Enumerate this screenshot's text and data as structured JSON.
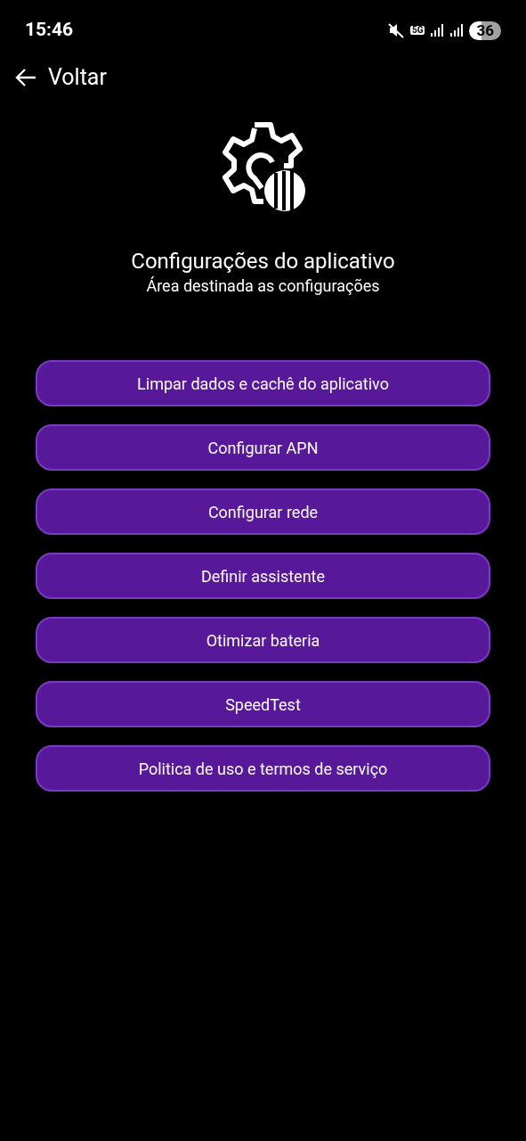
{
  "status_bar": {
    "time": "15:46",
    "network": "5G",
    "battery": "36"
  },
  "back": {
    "label": "Voltar"
  },
  "header": {
    "title": "Configurações do aplicativo",
    "subtitle": "Área destinada as configurações"
  },
  "buttons": [
    {
      "label": "Limpar dados e cachê do aplicativo"
    },
    {
      "label": "Configurar APN"
    },
    {
      "label": "Configurar rede"
    },
    {
      "label": "Definir assistente"
    },
    {
      "label": "Otimizar bateria"
    },
    {
      "label": "SpeedTest"
    },
    {
      "label": "Politica de uso e termos de serviço"
    }
  ]
}
